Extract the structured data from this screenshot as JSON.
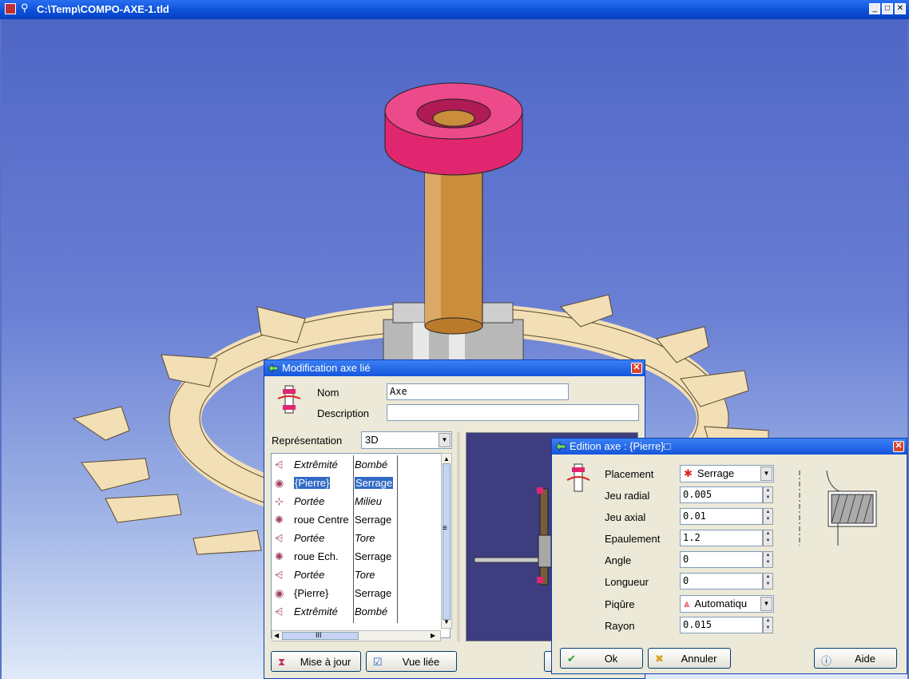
{
  "window": {
    "title": "C:\\Temp\\COMPO-AXE-1.tld",
    "btn_min": "_",
    "btn_max": "□",
    "btn_close": "✕"
  },
  "mod_dialog": {
    "title": "Modification axe lié",
    "nom_label": "Nom",
    "nom_value": "Axe",
    "description_label": "Description",
    "description_value": "",
    "representation_label": "Représentation",
    "representation_value": "3D",
    "rows": [
      {
        "c1": "Extrêmité",
        "c2": "Bombé",
        "italic": true,
        "icon": "⩤",
        "selected": false
      },
      {
        "c1": "{Pierre}",
        "c2": "Serrage",
        "italic": false,
        "icon": "◉",
        "selected": true
      },
      {
        "c1": "Portée",
        "c2": "Milieu",
        "italic": true,
        "icon": "⊹",
        "selected": false
      },
      {
        "c1": "roue Centre",
        "c2": "Serrage",
        "italic": false,
        "icon": "✺",
        "selected": false
      },
      {
        "c1": "Portée",
        "c2": "Tore",
        "italic": true,
        "icon": "⩤",
        "selected": false
      },
      {
        "c1": "roue Ech.",
        "c2": "Serrage",
        "italic": false,
        "icon": "✺",
        "selected": false
      },
      {
        "c1": "Portée",
        "c2": "Tore",
        "italic": true,
        "icon": "⩤",
        "selected": false
      },
      {
        "c1": "{Pierre}",
        "c2": "Serrage",
        "italic": false,
        "icon": "◉",
        "selected": false
      },
      {
        "c1": "Extrêmité",
        "c2": "Bombé",
        "italic": true,
        "icon": "⩤",
        "selected": false
      }
    ],
    "btn_update": "Mise à jour",
    "btn_linked_view": "Vue liée",
    "hscroll_grip": "III",
    "vscroll_grip": "≡"
  },
  "edit_dialog": {
    "title": "Edition axe : {Pierre}",
    "title_suffix": "□",
    "placement_label": "Placement",
    "placement_value": "Serrage",
    "fields": [
      {
        "label": "Jeu radial",
        "value": "0.005"
      },
      {
        "label": "Jeu axial",
        "value": "0.01"
      },
      {
        "label": "Epaulement",
        "value": "1.2"
      },
      {
        "label": "Angle",
        "value": "0"
      },
      {
        "label": "Longueur",
        "value": "0"
      }
    ],
    "piqure_label": "Piqûre",
    "piqure_value": "Automatiqu",
    "rayon_label": "Rayon",
    "rayon_value": "0.015",
    "btn_ok": "Ok",
    "btn_cancel": "Annuler",
    "btn_help": "Aide"
  },
  "colors": {
    "viewport_bg": "#5a72c4",
    "selection": "#316ac5",
    "jewel": "#e0266f",
    "axle": "#c98d3c",
    "wheel": "#f2dfb5"
  }
}
